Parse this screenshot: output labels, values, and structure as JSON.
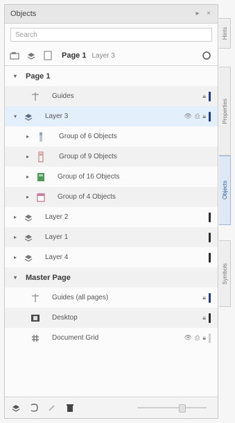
{
  "title": "Objects",
  "search_placeholder": "Search",
  "toolbar": {
    "page": "Page 1",
    "layer": "Layer 3"
  },
  "side_tabs": [
    "Hints",
    "Properties",
    "Objects",
    "Symbols"
  ],
  "rows": [
    {
      "label": "Page 1"
    },
    {
      "label": "Guides"
    },
    {
      "label": "Layer 3"
    },
    {
      "label": "Group of 6 Objects"
    },
    {
      "label": "Group of 9 Objects"
    },
    {
      "label": "Group of 16 Objects"
    },
    {
      "label": "Group of 4 Objects"
    },
    {
      "label": "Layer 2"
    },
    {
      "label": "Layer 1"
    },
    {
      "label": "Layer 4"
    },
    {
      "label": "Master Page"
    },
    {
      "label": "Guides (all pages)"
    },
    {
      "label": "Desktop"
    },
    {
      "label": "Document Grid"
    }
  ]
}
